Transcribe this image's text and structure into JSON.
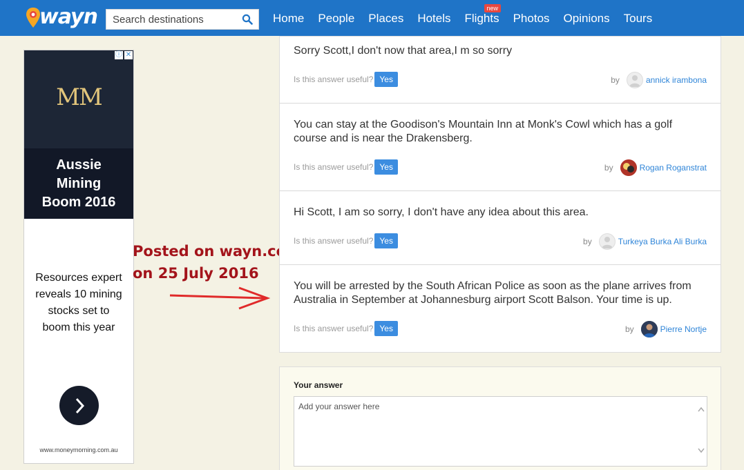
{
  "header": {
    "logo_text": "wayn",
    "search_placeholder": "Search destinations",
    "nav": [
      "Home",
      "People",
      "Places",
      "Hotels",
      "Flights",
      "Photos",
      "Opinions",
      "Tours"
    ],
    "flights_badge": "new",
    "brand_color": "#1f74c7"
  },
  "ad": {
    "logo": "MM",
    "headline": [
      "Aussie",
      "Mining",
      "Boom 2016"
    ],
    "body": [
      "Resources expert",
      "reveals 10 mining",
      "stocks set to",
      "boom this year"
    ],
    "url": "www.moneymorning.com.au",
    "icons": [
      "info-icon",
      "close-icon",
      "chevron-right-icon"
    ]
  },
  "annotation": {
    "line1": "Posted on wayn.com",
    "line2": "on 25 July 2016",
    "color": "#a3141b"
  },
  "answers": [
    {
      "text": "Sorry Scott,I don't now that area,I m so sorry",
      "useful_label": "Is this answer useful?",
      "yes_label": "Yes",
      "by_label": "by",
      "author": "annick irambona"
    },
    {
      "text": "You can stay at the Goodison's Mountain Inn at Monk's Cowl which has a golf course and is near the Drakensberg.",
      "useful_label": "Is this answer useful?",
      "yes_label": "Yes",
      "by_label": "by",
      "author": "Rogan Roganstrat"
    },
    {
      "text": "Hi Scott, I am so sorry, I don't have any idea about this area.",
      "useful_label": "Is this answer useful?",
      "yes_label": "Yes",
      "by_label": "by",
      "author": "Turkeya Burka Ali Burka"
    },
    {
      "text": "You will be arrested by the South African Police as soon as the plane arrives from Australia in September at Johannesburg airport Scott Balson. Your time is up.",
      "useful_label": "Is this answer useful?",
      "yes_label": "Yes",
      "by_label": "by",
      "author": "Pierre Nortje"
    }
  ],
  "your_answer": {
    "label": "Your answer",
    "placeholder": "Add your answer here"
  }
}
